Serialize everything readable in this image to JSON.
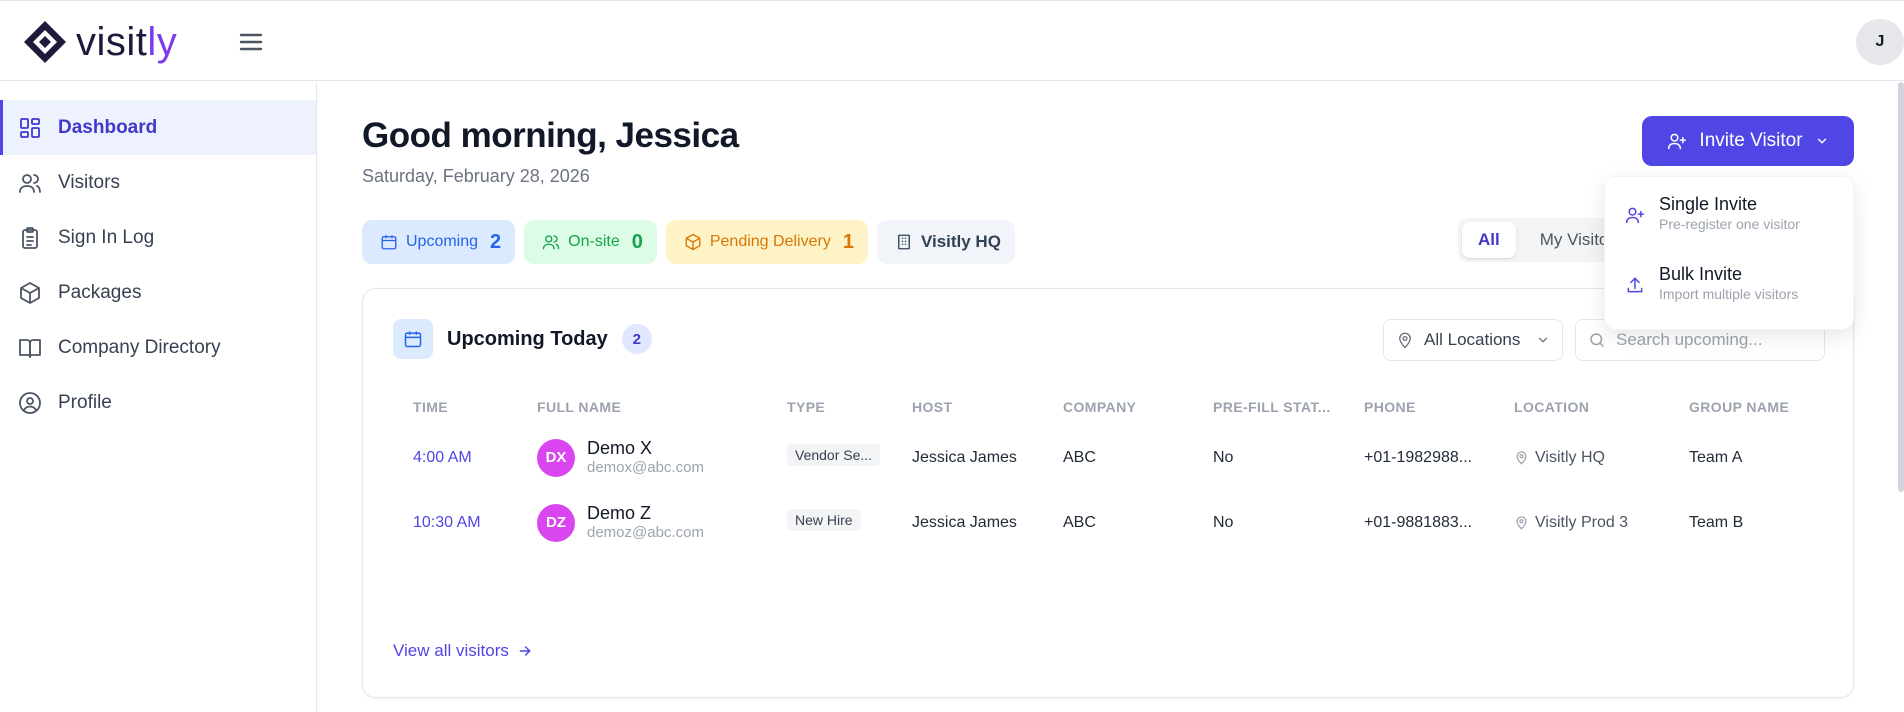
{
  "app": {
    "logo_text_main": "visit",
    "logo_text_accent": "ly",
    "user_initial": "J"
  },
  "sidebar": {
    "items": [
      {
        "label": "Dashboard",
        "icon": "dashboard-icon",
        "active": true
      },
      {
        "label": "Visitors",
        "icon": "users-icon"
      },
      {
        "label": "Sign In Log",
        "icon": "clipboard-icon"
      },
      {
        "label": "Packages",
        "icon": "package-icon"
      },
      {
        "label": "Company Directory",
        "icon": "book-icon"
      },
      {
        "label": "Profile",
        "icon": "user-circle-icon"
      }
    ]
  },
  "header": {
    "greeting": "Good morning, Jessica",
    "date": "Saturday, February 28, 2026",
    "invite_button": "Invite Visitor"
  },
  "chips": {
    "upcoming": {
      "label": "Upcoming",
      "count": "2"
    },
    "onsite": {
      "label": "On-site",
      "count": "0"
    },
    "pending": {
      "label": "Pending Delivery",
      "count": "1"
    },
    "location": {
      "label": "Visitly HQ"
    }
  },
  "toggle": {
    "all": "All",
    "mine": "My Visitors"
  },
  "card": {
    "title": "Upcoming Today",
    "count": "2",
    "location_filter": "All Locations",
    "search_placeholder": "Search upcoming...",
    "view_all": "View all visitors"
  },
  "table": {
    "columns": [
      "TIME",
      "FULL NAME",
      "TYPE",
      "HOST",
      "COMPANY",
      "PRE-FILL STAT...",
      "PHONE",
      "LOCATION",
      "GROUP NAME"
    ],
    "rows": [
      {
        "time": "4:00 AM",
        "initials": "DX",
        "name": "Demo X",
        "email": "demox@abc.com",
        "type": "Vendor Se...",
        "host": "Jessica James",
        "company": "ABC",
        "prefill": "No",
        "phone": "+01-1982988...",
        "location": "Visitly HQ",
        "group": "Team A"
      },
      {
        "time": "10:30 AM",
        "initials": "DZ",
        "name": "Demo Z",
        "email": "demoz@abc.com",
        "type": "New Hire",
        "host": "Jessica James",
        "company": "ABC",
        "prefill": "No",
        "phone": "+01-9881883...",
        "location": "Visitly Prod 3",
        "group": "Team B"
      }
    ]
  },
  "dropdown": {
    "items": [
      {
        "title": "Single Invite",
        "subtitle": "Pre-register one visitor",
        "icon": "user-plus-icon"
      },
      {
        "title": "Bulk Invite",
        "subtitle": "Import multiple visitors",
        "icon": "upload-icon"
      }
    ]
  },
  "colors": {
    "accent": "#4f46e5",
    "avatar_pink": "#d946ef",
    "upcoming_chip": "#dbeafe",
    "onsite_chip": "#dcfce7",
    "pending_chip": "#fef3c7"
  }
}
